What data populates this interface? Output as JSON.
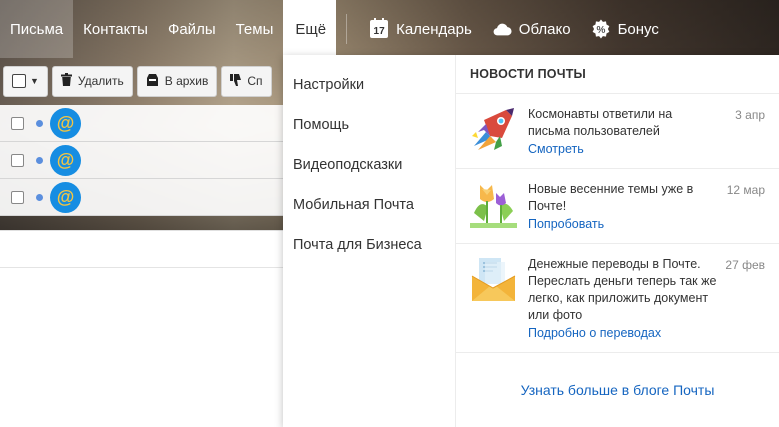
{
  "nav": {
    "items": [
      {
        "label": "Письма"
      },
      {
        "label": "Контакты"
      },
      {
        "label": "Файлы"
      },
      {
        "label": "Темы"
      }
    ],
    "more_label": "Ещё",
    "services": [
      {
        "label": "Календарь",
        "icon": "calendar-icon",
        "badge": "17"
      },
      {
        "label": "Облако",
        "icon": "cloud-icon"
      },
      {
        "label": "Бонус",
        "icon": "bonus-icon"
      }
    ]
  },
  "toolbar": {
    "delete_label": "Удалить",
    "archive_label": "В архив",
    "spam_label": "Сп"
  },
  "menu": {
    "items": [
      {
        "label": "Настройки"
      },
      {
        "label": "Помощь"
      },
      {
        "label": "Видеоподсказки"
      },
      {
        "label": "Мобильная Почта"
      },
      {
        "label": "Почта для Бизнеса"
      }
    ]
  },
  "news": {
    "header": "НОВОСТИ ПОЧТЫ",
    "items": [
      {
        "text": "Космонавты ответили на письма пользователей",
        "link": "Смотреть",
        "date": "3 апр",
        "icon": "rocket-icon"
      },
      {
        "text": "Новые весенние темы уже в Почте!",
        "link": "Попробовать",
        "date": "12 мар",
        "icon": "tulips-icon"
      },
      {
        "text": "Денежные переводы в Почте. Переслать деньги теперь так же легко, как приложить документ или фото",
        "link": "Подробно о переводах",
        "date": "27 фев",
        "icon": "money-envelope-icon"
      }
    ],
    "footer_link": "Узнать больше в блоге Почты"
  },
  "mail": {
    "avatar_symbol": "@"
  },
  "colors": {
    "link": "#1565c0",
    "avatar": "#168de2",
    "unread_dot": "#5b8fde"
  }
}
